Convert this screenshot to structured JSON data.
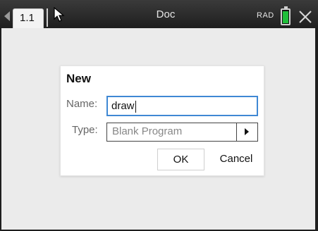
{
  "titlebar": {
    "tab_label": "1.1",
    "doc_title": "Doc",
    "angle_mode": "RAD",
    "battery_icon": "battery-icon",
    "close_icon": "close-icon",
    "nav_icon": "nav-left-arrow-icon",
    "cursor_icon": "pointer-cursor-icon"
  },
  "dialog": {
    "title": "New",
    "name_label": "Name:",
    "name_value": "draw",
    "type_label": "Type:",
    "type_value": "Blank Program",
    "ok_label": "OK",
    "cancel_label": "Cancel"
  },
  "colors": {
    "focus_border": "#3f88d4",
    "battery_fill": "#1fbf3a"
  }
}
